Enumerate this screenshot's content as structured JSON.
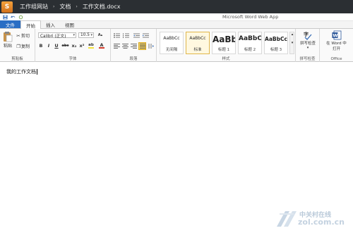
{
  "header": {
    "logo_text": "S",
    "breadcrumb": [
      "工作组网站",
      "文档",
      "工作文档.docx"
    ],
    "separator": "›"
  },
  "app_title": "Microsoft Word Web App",
  "tabs": [
    {
      "label": "文件",
      "kind": "file"
    },
    {
      "label": "开始",
      "kind": "active"
    },
    {
      "label": "插入",
      "kind": "normal"
    },
    {
      "label": "视图",
      "kind": "normal"
    }
  ],
  "ribbon": {
    "clipboard": {
      "label": "剪贴板",
      "paste": "粘贴",
      "cut": "剪切",
      "copy": "复制"
    },
    "font": {
      "label": "字体",
      "font_name": "Calibri (正文)",
      "font_size": "10.5",
      "bold": "B",
      "italic": "I",
      "underline": "U",
      "strike": "abc",
      "subscript": "x₂",
      "superscript": "x²",
      "highlight": "ab",
      "color": "A"
    },
    "paragraph": {
      "label": "段落"
    },
    "styles": {
      "label": "样式",
      "items": [
        {
          "sample": "AaBbCc",
          "name": "无间隔",
          "size": "6px",
          "selected": false
        },
        {
          "sample": "AaBbCc",
          "name": "标准",
          "size": "6px",
          "selected": true
        },
        {
          "sample": "AaBb",
          "name": "标题 1",
          "size": "12px",
          "selected": false
        },
        {
          "sample": "AaBbC",
          "name": "标题 2",
          "size": "10px",
          "selected": false
        },
        {
          "sample": "AaBbCc",
          "name": "标题 3",
          "size": "8.5px",
          "selected": false
        }
      ]
    },
    "spelling": {
      "label": "拼写检查",
      "button": "拼写检查"
    },
    "office": {
      "label": "Office",
      "button_line1": "在 Word 中",
      "button_line2": "打开"
    }
  },
  "document": {
    "text": "我的工作文档"
  },
  "watermark": {
    "line1": "中关村在线",
    "line2": "zol.com.cn"
  },
  "colors": {
    "topbar": "#2b2f33",
    "file_tab": "#2a6ec4",
    "accent_orange": "#e8892b",
    "selected_style": "#e0b64a"
  }
}
